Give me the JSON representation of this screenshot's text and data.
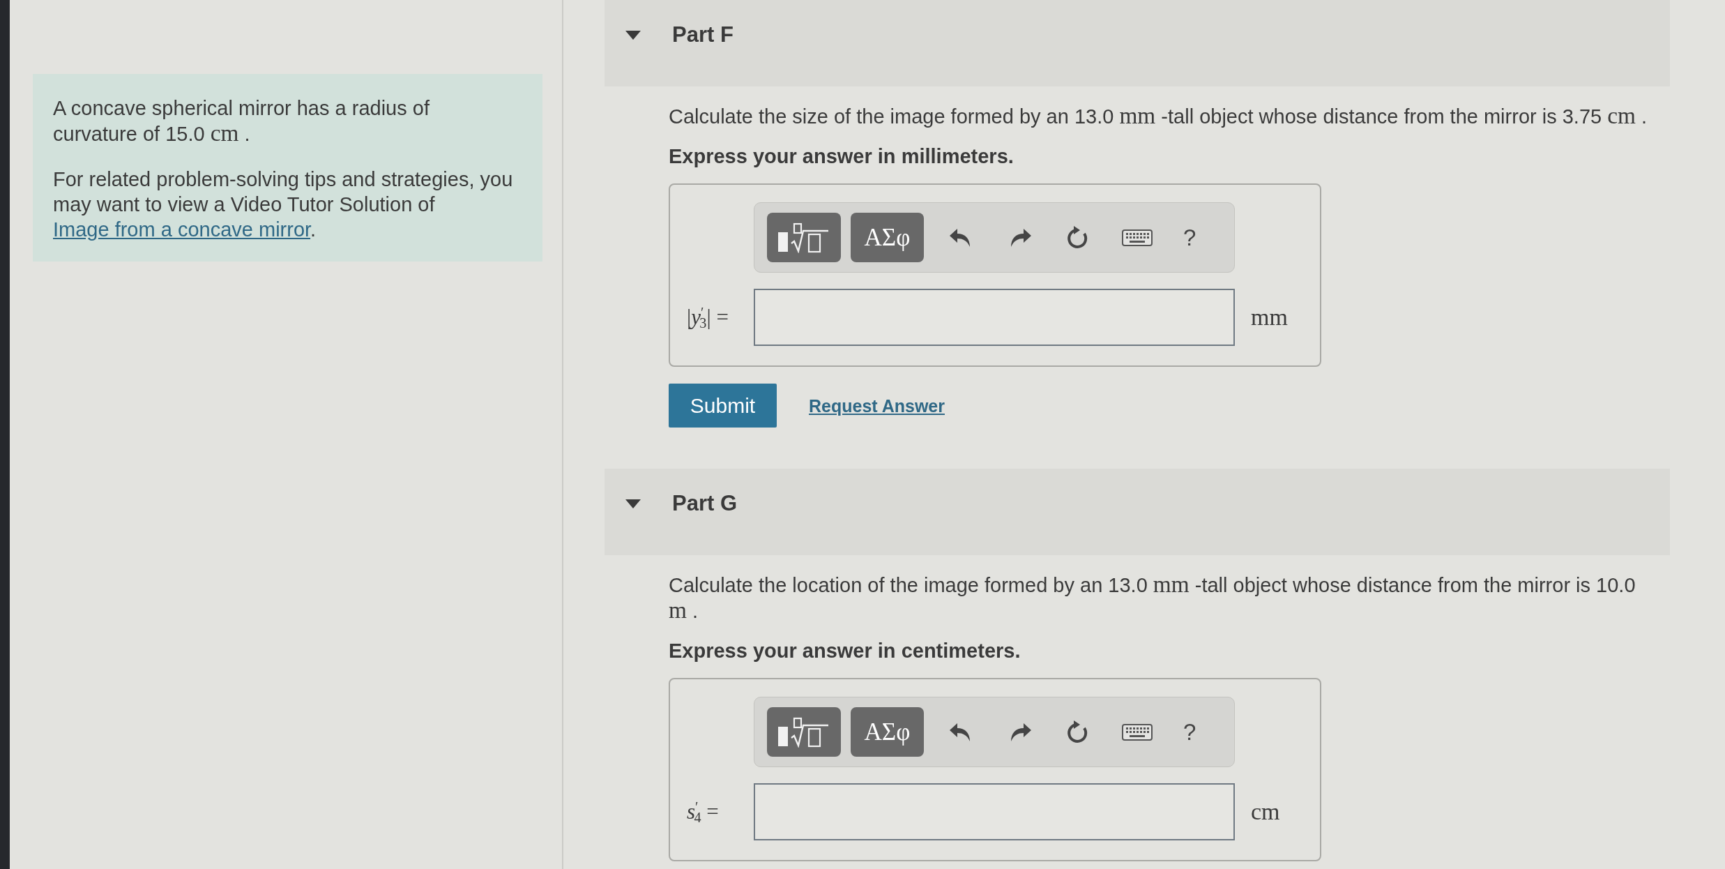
{
  "sidebar": {
    "paragraphs": [
      {
        "runs": [
          {
            "kind": "text",
            "text": "A concave spherical mirror has a radius of curvature of 15.0 "
          },
          {
            "kind": "math",
            "text": "cm"
          },
          {
            "kind": "text",
            "text": " ."
          }
        ]
      },
      {
        "runs": [
          {
            "kind": "text",
            "text": "For related problem-solving tips and strategies, you may want to view a Video Tutor Solution of "
          },
          {
            "kind": "link",
            "text": "Image from a concave mirror"
          },
          {
            "kind": "text",
            "text": "."
          }
        ]
      }
    ]
  },
  "parts": [
    {
      "title": "Part F",
      "expanded": true,
      "question": [
        {
          "kind": "text",
          "text": "Calculate the size of the image formed by an 13.0 "
        },
        {
          "kind": "math",
          "text": "mm"
        },
        {
          "kind": "text",
          "text": " -tall object whose distance from the mirror is 3.75 "
        },
        {
          "kind": "math",
          "text": "cm"
        },
        {
          "kind": "text",
          "text": " ."
        }
      ],
      "instruction": "Express your answer in millimeters.",
      "toolbar": [
        {
          "kind": "templates"
        },
        {
          "kind": "symbols",
          "label": "ΑΣφ"
        },
        {
          "kind": "undo"
        },
        {
          "kind": "redo"
        },
        {
          "kind": "reset"
        },
        {
          "kind": "keyboard"
        },
        {
          "kind": "help",
          "label": "?"
        }
      ],
      "answer": {
        "label": "|*y*$^{′}$$_{3}$| =",
        "unit": "mm"
      },
      "actions": {
        "submit": "Submit",
        "request": "Request Answer"
      }
    },
    {
      "title": "Part G",
      "expanded": true,
      "question": [
        {
          "kind": "text",
          "text": "Calculate the location of the image formed by an 13.0 "
        },
        {
          "kind": "math",
          "text": "mm"
        },
        {
          "kind": "text",
          "text": " -tall object whose distance from the mirror is 10.0 "
        },
        {
          "kind": "math",
          "text": "m"
        },
        {
          "kind": "text",
          "text": " ."
        }
      ],
      "instruction": "Express your answer in centimeters.",
      "toolbar": [
        {
          "kind": "templates"
        },
        {
          "kind": "symbols",
          "label": "ΑΣφ"
        },
        {
          "kind": "undo"
        },
        {
          "kind": "redo"
        },
        {
          "kind": "reset"
        },
        {
          "kind": "keyboard"
        },
        {
          "kind": "help",
          "label": "?"
        }
      ],
      "answer": {
        "label": "*s*$^{′}$$_{4}$ =",
        "unit": "cm"
      }
    }
  ]
}
